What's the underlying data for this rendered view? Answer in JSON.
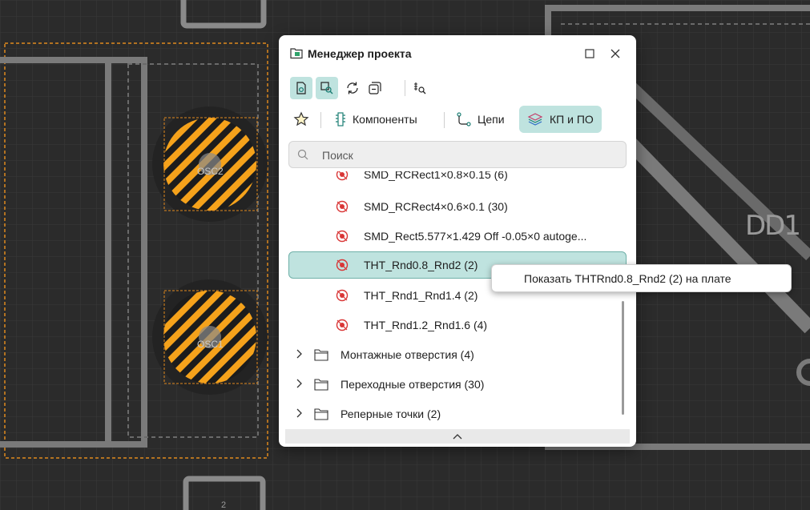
{
  "window": {
    "title": "Менеджер проекта",
    "maximize_icon": "square-icon",
    "close_icon": "close-icon"
  },
  "toolbar": {
    "buttons": [
      {
        "icon": "show-on-board-icon",
        "active": true
      },
      {
        "icon": "zoom-to-selection-icon",
        "active": true
      },
      {
        "icon": "refresh-icon",
        "active": false
      },
      {
        "icon": "collapse-all-icon",
        "active": false
      },
      {
        "icon": "filter-layers-icon",
        "active": false
      }
    ]
  },
  "tabs": {
    "favorites_icon": "star-icon",
    "components": "Компоненты",
    "nets": "Цепи",
    "pads_vias": "КП и ПО"
  },
  "search": {
    "placeholder": "Поиск"
  },
  "list": {
    "partial_row": "SMD_RCRect1×0.8×0.15 (6)",
    "rows": [
      {
        "label": "SMD_RCRect4×0.6×0.1 (30)"
      },
      {
        "label": "SMD_Rect5.577×1.429 Off -0.05×0 autoge..."
      },
      {
        "label": "THT_Rnd0.8_Rnd2 (2)",
        "selected": true
      },
      {
        "label": "THT_Rnd1_Rnd1.4 (2)"
      },
      {
        "label": "THT_Rnd1.2_Rnd1.6 (4)"
      }
    ],
    "folders": [
      {
        "label": "Монтажные отверстия (4)"
      },
      {
        "label": "Переходные отверстия (30)"
      },
      {
        "label": "Реперные точки (2)"
      }
    ]
  },
  "tooltip": {
    "text": "Показать THTRnd0.8_Rnd2 (2) на плате"
  },
  "board": {
    "component_label": "DD1",
    "pad_bottom_label": "2"
  },
  "colors": {
    "accent": "#bfe3df",
    "accent_border": "#6fb0a8",
    "pad_stripe_orange": "#f5a21b",
    "pad_icon_red": "#d93636",
    "board_bg": "#2b2b2b"
  }
}
